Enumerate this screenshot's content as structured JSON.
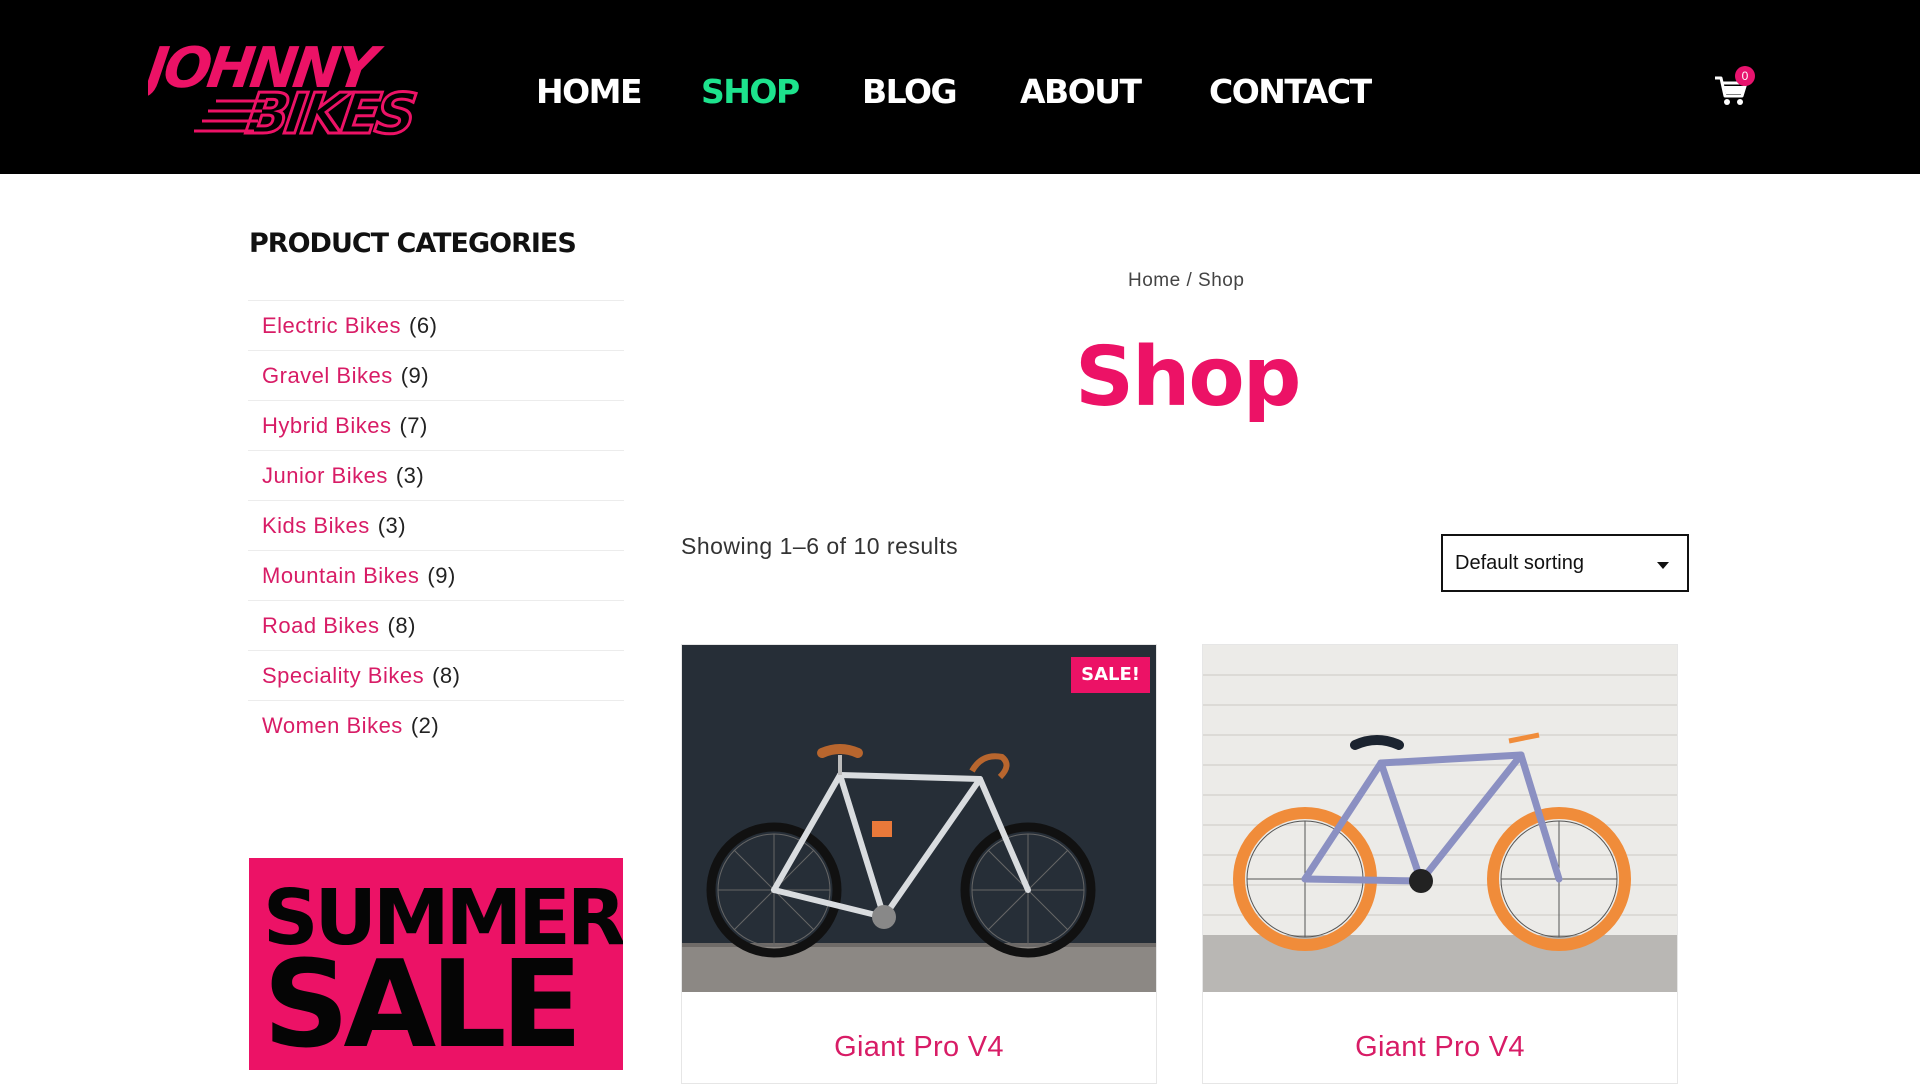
{
  "brand": {
    "logo_line1": "JOHNNY",
    "logo_line2": "BIKES",
    "accent_color": "#ec1266",
    "nav_active_color": "#1de38d"
  },
  "nav": {
    "items": [
      {
        "label": "HOME",
        "active": false
      },
      {
        "label": "SHOP",
        "active": true
      },
      {
        "label": "BLOG",
        "active": false
      },
      {
        "label": "ABOUT",
        "active": false
      },
      {
        "label": "CONTACT",
        "active": false
      }
    ],
    "cart_count": "0",
    "cart_icon": "cart-icon"
  },
  "sidebar": {
    "title": "PRODUCT CATEGORIES",
    "categories": [
      {
        "label": "Electric Bikes",
        "count": "(6)"
      },
      {
        "label": "Gravel Bikes",
        "count": "(9)"
      },
      {
        "label": "Hybrid Bikes",
        "count": "(7)"
      },
      {
        "label": "Junior Bikes",
        "count": "(3)"
      },
      {
        "label": "Kids Bikes",
        "count": "(3)"
      },
      {
        "label": "Mountain Bikes",
        "count": "(9)"
      },
      {
        "label": "Road Bikes",
        "count": "(8)"
      },
      {
        "label": "Speciality Bikes",
        "count": "(8)"
      },
      {
        "label": "Women Bikes",
        "count": "(2)"
      }
    ],
    "promo": {
      "line1": "SUMMER",
      "line2": "SALE"
    }
  },
  "main": {
    "breadcrumb": {
      "home": "Home",
      "separator": " / ",
      "current": "Shop"
    },
    "title": "Shop",
    "result_count": "Showing 1–6 of 10 results",
    "sorting": {
      "selected": "Default sorting"
    }
  },
  "products": [
    {
      "name": "Giant Pro V4",
      "badge": "SALE!"
    },
    {
      "name": "Giant Pro V4"
    }
  ]
}
